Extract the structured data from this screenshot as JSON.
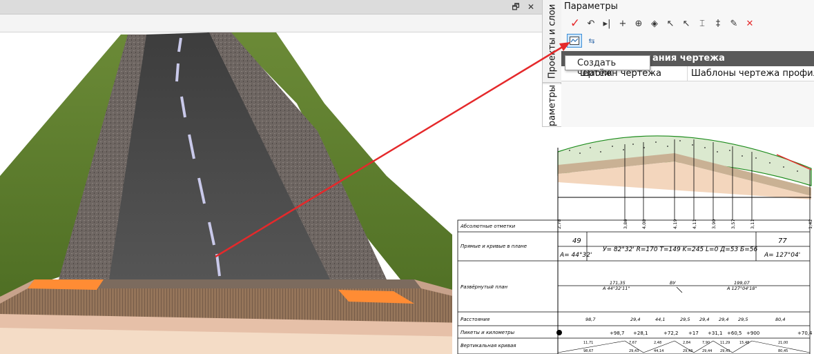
{
  "panel": {
    "title": "Параметры",
    "section_header": "ания чертежа",
    "property_label": "Шаблон чертежа",
    "property_value": "Шаблоны чертежа профиля"
  },
  "tabs": {
    "projects": "Проекты и слои",
    "parameters": "раметры"
  },
  "tooltip": "Создать чертёж",
  "toolbar_icons": [
    "check-icon",
    "undo-arrow-icon",
    "step-icon",
    "crosshair-icon",
    "target-icon",
    "target-diamond-icon",
    "pick-point-icon",
    "pick-text-icon",
    "section-icon",
    "node-icon",
    "eyedropper-icon",
    "delete-icon"
  ],
  "colors": {
    "accent_red": "#e5292b",
    "header_bg": "#595959",
    "road": "#4b4b4b",
    "grass": "#5a7a2c",
    "stone": "#6a6460",
    "orange": "#ff8c34"
  },
  "drawing": {
    "rows": [
      "Абсолютные отметки",
      "Прямые и кривые в плане",
      "Развёрнутый план",
      "Расстояния",
      "Пикеты и километры",
      "Вертикальная кривая"
    ],
    "elevations": [
      "2,78",
      "3,86",
      "4,08",
      "4,19",
      "4,11",
      "3,90",
      "3,57",
      "3,11",
      "1,42"
    ],
    "plan": {
      "left_num": "49",
      "left_azimuth": "А= 44°32'",
      "curve_text": "У= 82°32' R=170 T=149 K=245 L=0 Д=53 Б=56",
      "right_num": "77",
      "right_azimuth": "А= 127°04'"
    },
    "unfolded": {
      "left_top": "171,35",
      "left_bottom": "А 44°32'11\"",
      "center": "ВУ",
      "right_top": "199,07",
      "right_bottom": "А 127°04'18\""
    },
    "distances": [
      "98,7",
      "29,4",
      "44,1",
      "29,5",
      "29,4",
      "29,4",
      "29,5",
      "80,4"
    ],
    "pickets": [
      "+98,7",
      "+28,1",
      "+72,2",
      "+17",
      "+31,1",
      "+60,5",
      "+900",
      "+70,4"
    ],
    "vertical_curve": {
      "top": [
        "11,71",
        "7,67",
        "2,48",
        "2,84",
        "7,90",
        "11,29",
        "15,48",
        "21,00"
      ],
      "bottom": [
        "98,67",
        "29,43",
        "44,14",
        "29,43",
        "29,44",
        "29,43",
        "80,45"
      ]
    }
  }
}
